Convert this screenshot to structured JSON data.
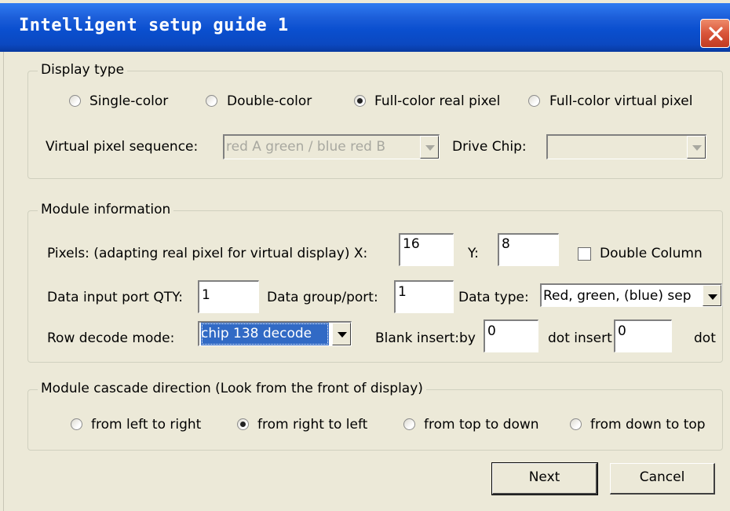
{
  "window": {
    "title": "Intelligent setup guide 1"
  },
  "display_type": {
    "legend": "Display type",
    "options": [
      "Single-color",
      "Double-color",
      "Full-color real pixel",
      "Full-color virtual pixel"
    ],
    "selected": "Full-color real pixel",
    "virtual_sequence_label": "Virtual pixel sequence:",
    "virtual_sequence_value": "red A green / blue red B",
    "drive_chip_label": "Drive Chip:",
    "drive_chip_value": ""
  },
  "module_info": {
    "legend": "Module information",
    "pixels_label": "Pixels: (adapting real pixel for virtual display) X:",
    "x_value": "16",
    "y_label": "Y:",
    "y_value": "8",
    "double_column_label": "Double Column",
    "double_column_checked": false,
    "port_qty_label": "Data input port QTY:",
    "port_qty_value": "1",
    "group_port_label": "Data group/port:",
    "group_port_value": "1",
    "data_type_label": "Data type:",
    "data_type_value": "Red, green, (blue) sep",
    "row_decode_label": "Row decode mode:",
    "row_decode_value": "chip 138 decode",
    "blank_insert_label": "Blank insert:by",
    "blank_insert_value": "0",
    "dot_insert_label": "dot insert",
    "dot_insert_value": "0",
    "dot_label": "dot"
  },
  "cascade": {
    "legend": "Module cascade direction (Look from the front of display)",
    "options": [
      "from left to right",
      "from right to left",
      "from top to down",
      "from down to top"
    ],
    "selected": "from right to left"
  },
  "buttons": {
    "next": "Next",
    "cancel": "Cancel"
  },
  "colors": {
    "titlebar": "#0a4fcf",
    "dialog_bg": "#ece9d8",
    "selection": "#316ac5",
    "close": "#d9553a"
  }
}
